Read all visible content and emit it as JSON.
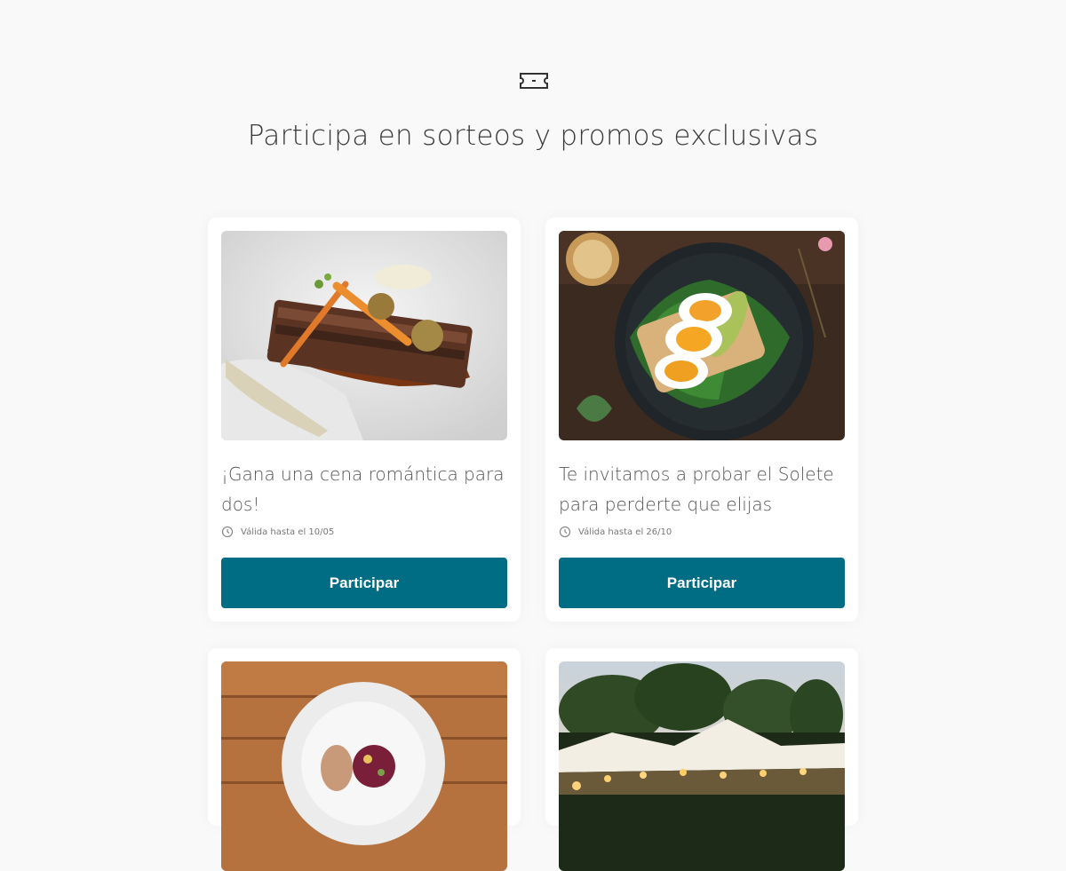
{
  "page": {
    "title": "Participa en sorteos y promos exclusivas",
    "icon": "ticket-icon"
  },
  "cards": [
    {
      "title": "¡Gana una cena  romántica para dos!",
      "date": "Válida hasta el 10/05",
      "button_label": "Participar",
      "image": "plated-meat-dish-photo"
    },
    {
      "title": "Te invitamos a probar el Solete para perderte que elijas",
      "date": "Válida hasta el 26/10",
      "button_label": "Participar",
      "image": "egg-avocado-toast-photo"
    },
    {
      "image": "plate-on-wooden-table-photo"
    },
    {
      "image": "garden-tent-restaurant-photo"
    }
  ],
  "colors": {
    "accent": "#006d84",
    "background": "#f9f9f9"
  }
}
